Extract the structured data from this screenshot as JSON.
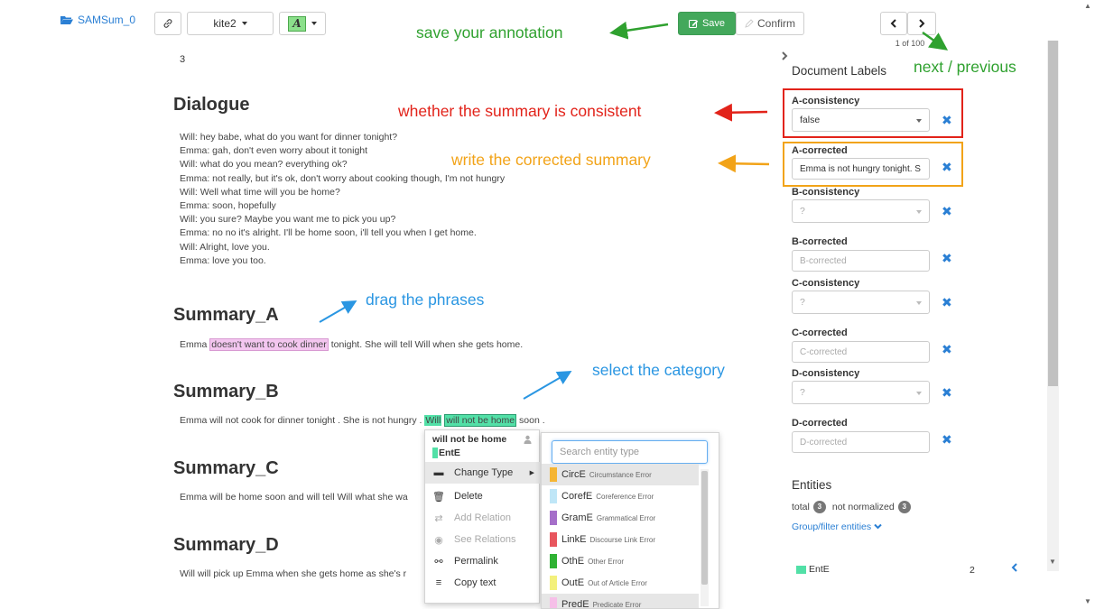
{
  "topbar": {
    "collection": "SAMSum_0",
    "user_dropdown": "kite2",
    "save_label": "Save",
    "confirm_label": "Confirm",
    "pager": "1 of 100"
  },
  "document": {
    "number": "3",
    "dialogue_heading": "Dialogue",
    "dialogue_lines": [
      "Will: hey babe, what do you want for dinner tonight?",
      "Emma:  gah, don't even worry about it tonight",
      "Will: what do you mean? everything ok?",
      "Emma: not really, but it's ok, don't worry about cooking though, I'm not hungry",
      "Will: Well what time will you be home?",
      "Emma: soon, hopefully",
      "Will: you sure? Maybe you want me to pick you up?",
      "Emma: no no it's alright. I'll be home soon, i'll tell you when I get home.",
      "Will: Alright, love you.",
      "Emma: love you too."
    ],
    "summary_a": {
      "heading": "Summary_A",
      "before": "Emma ",
      "highlight": "doesn't want to cook dinner",
      "after": " tonight. She will tell Will when she gets home."
    },
    "summary_b": {
      "heading": "Summary_B",
      "before": "Emma will not cook for dinner tonight . She is not hungry . ",
      "hl1": "Will",
      "hl2": "will not be home",
      "after": " soon ."
    },
    "summary_c": {
      "heading": "Summary_C",
      "text": "Emma will be home soon and will tell Will what she wa"
    },
    "summary_d": {
      "heading": "Summary_D",
      "text": "Will will pick up Emma when she gets home as she's r"
    }
  },
  "context_menu": {
    "selected_text": "will not be home",
    "entity_tag": "EntE",
    "items": [
      {
        "label": "Change Type",
        "icon": "folder-icon"
      },
      {
        "label": "Delete",
        "icon": "trash-icon"
      },
      {
        "label": "Add Relation",
        "icon": "arrows-icon"
      },
      {
        "label": "See Relations",
        "icon": "eye-icon"
      },
      {
        "label": "Permalink",
        "icon": "link-icon"
      },
      {
        "label": "Copy text",
        "icon": "lines-icon"
      }
    ]
  },
  "entity_submenu": {
    "search_placeholder": "Search entity type",
    "types": [
      {
        "code": "CircE",
        "desc": "Circumstance Error",
        "color": "#f5b533"
      },
      {
        "code": "CorefE",
        "desc": "Coreference Error",
        "color": "#bfe6f7"
      },
      {
        "code": "GramE",
        "desc": "Grammatical Error",
        "color": "#a56fc9"
      },
      {
        "code": "LinkE",
        "desc": "Discourse Link Error",
        "color": "#e8565e"
      },
      {
        "code": "OthE",
        "desc": "Other Error",
        "color": "#2fb233"
      },
      {
        "code": "OutE",
        "desc": "Out of Article Error",
        "color": "#f3f07c"
      },
      {
        "code": "PredE",
        "desc": "Predicate Error",
        "color": "#f6bfe8"
      }
    ]
  },
  "panel": {
    "title": "Document Labels",
    "fields": {
      "a_consistency": {
        "label": "A-consistency",
        "value": "false"
      },
      "a_corrected": {
        "label": "A-corrected",
        "value": "Emma is not hungry tonight. S"
      },
      "b_consistency": {
        "label": "B-consistency",
        "value": "?"
      },
      "b_corrected": {
        "label": "B-corrected",
        "placeholder": "B-corrected"
      },
      "c_consistency": {
        "label": "C-consistency",
        "value": "?"
      },
      "c_corrected": {
        "label": "C-corrected",
        "placeholder": "C-corrected"
      },
      "d_consistency": {
        "label": "D-consistency",
        "value": "?"
      },
      "d_corrected": {
        "label": "D-corrected",
        "placeholder": "D-corrected"
      }
    },
    "entities": {
      "heading": "Entities",
      "total_label": "total",
      "total_count": "3",
      "not_normalized_label": "not normalized",
      "not_normalized_count": "3",
      "group_link": "Group/filter entities",
      "item_label": "EntE",
      "item_count": "2"
    }
  },
  "annotations": {
    "save": "save your annotation",
    "next": "next / previous",
    "consistent": "whether the summary is consistent",
    "corrected": "write the corrected summary",
    "drag": "drag the phrases",
    "category": "select the category"
  },
  "colors": {
    "accent_blue": "#2a7fd4",
    "save_green": "#43a85b",
    "ann_green": "#2fa12f",
    "ann_red": "#e2231a",
    "ann_orange": "#f2a318",
    "ann_blue": "#2a96e2",
    "entity_green": "#52e0a7"
  }
}
